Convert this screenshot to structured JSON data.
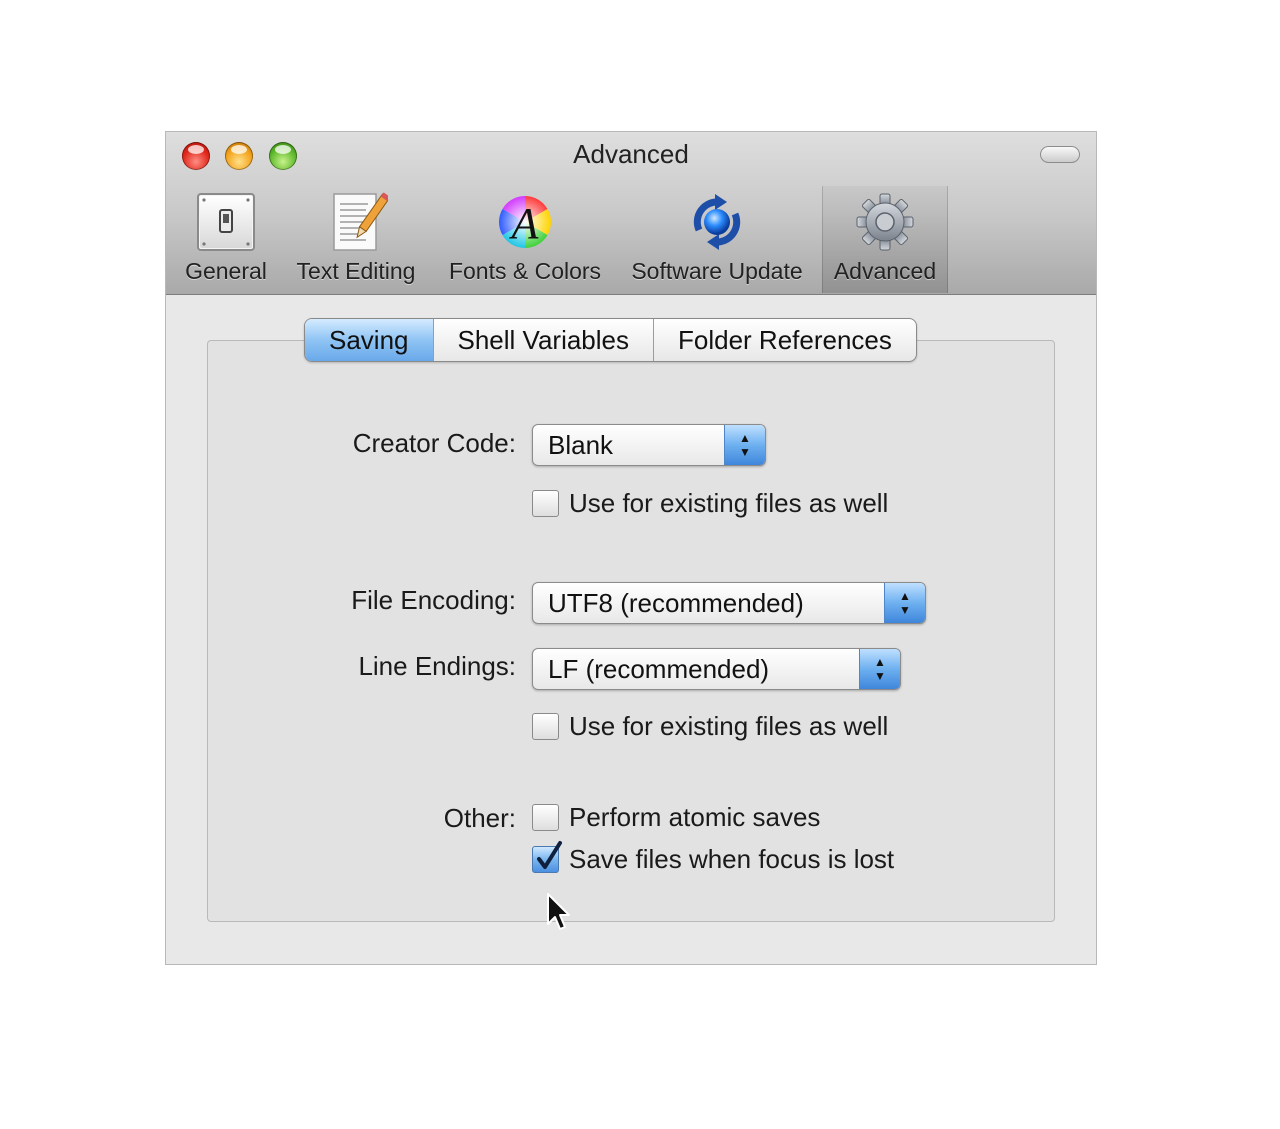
{
  "window": {
    "title": "Advanced"
  },
  "toolbar": {
    "items": [
      {
        "label": "General",
        "icon": "switch-icon"
      },
      {
        "label": "Text Editing",
        "icon": "document-pencil-icon"
      },
      {
        "label": "Fonts & Colors",
        "icon": "font-color-wheel-icon"
      },
      {
        "label": "Software Update",
        "icon": "update-arrows-icon"
      },
      {
        "label": "Advanced",
        "icon": "gear-icon",
        "selected": true
      }
    ]
  },
  "tabs": [
    {
      "label": "Saving",
      "selected": true
    },
    {
      "label": "Shell Variables"
    },
    {
      "label": "Folder References"
    }
  ],
  "form": {
    "creator_code": {
      "label": "Creator Code:",
      "value": "Blank"
    },
    "creator_existing": {
      "label": "Use for existing files as well",
      "checked": false
    },
    "file_encoding": {
      "label": "File Encoding:",
      "value": "UTF8 (recommended)"
    },
    "line_endings": {
      "label": "Line Endings:",
      "value": "LF (recommended)"
    },
    "line_existing": {
      "label": "Use for existing files as well",
      "checked": false
    },
    "other_label": "Other:",
    "atomic_saves": {
      "label": "Perform atomic saves",
      "checked": false
    },
    "save_focus_lost": {
      "label": "Save files when focus is lost",
      "checked": true
    }
  },
  "colors": {
    "selection_blue": "#6aa9ea",
    "window_bg": "#e8e8e8"
  }
}
